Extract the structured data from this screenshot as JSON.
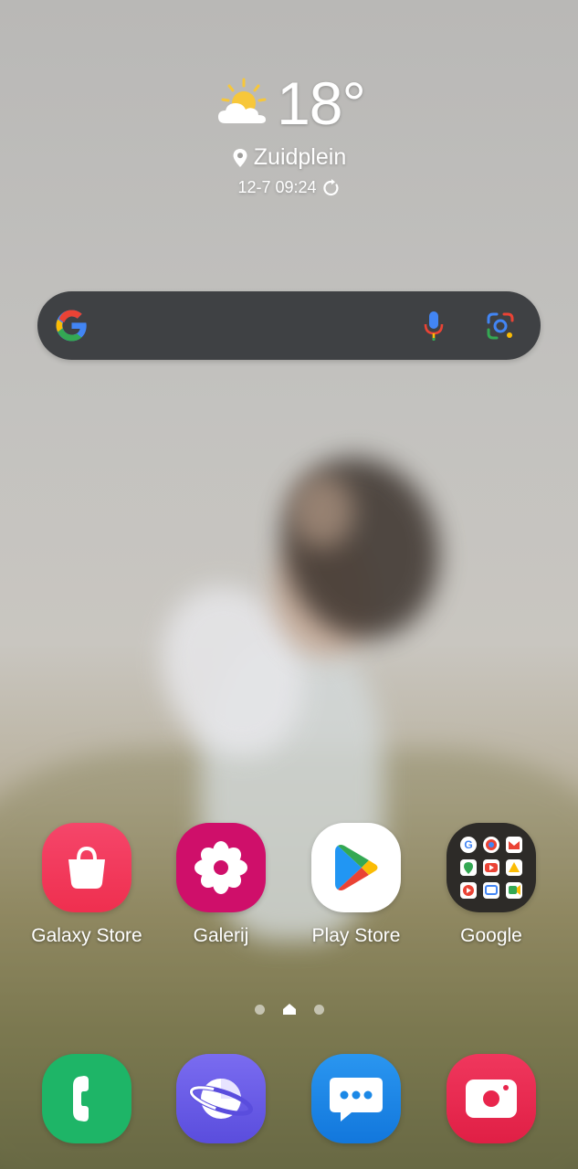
{
  "weather": {
    "icon": "partly-sunny-icon",
    "temperature": "18°",
    "location": "Zuidplein",
    "updated": "12-7 09:24"
  },
  "search": {
    "logo": "google-g-icon",
    "mic": "mic-icon",
    "lens": "google-lens-icon"
  },
  "apps": [
    {
      "label": "Galaxy Store",
      "icon": "galaxy-store-icon",
      "color": "#f1355b"
    },
    {
      "label": "Galerij",
      "icon": "gallery-icon",
      "color": "#cf0f6a"
    },
    {
      "label": "Play Store",
      "icon": "play-store-icon",
      "color": "#ffffff"
    },
    {
      "label": "Google",
      "icon": "google-folder-icon",
      "color": "#2b2b2b"
    }
  ],
  "page_indicator": {
    "pages": 3,
    "current": 2
  },
  "dock": [
    {
      "name": "phone",
      "icon": "phone-icon",
      "color": "#1eb567"
    },
    {
      "name": "internet",
      "icon": "samsung-internet-icon",
      "color": "#6a5ce8"
    },
    {
      "name": "messages",
      "icon": "messages-icon",
      "color": "#1b88e6"
    },
    {
      "name": "camera",
      "icon": "camera-icon",
      "color": "#e8254c"
    }
  ]
}
